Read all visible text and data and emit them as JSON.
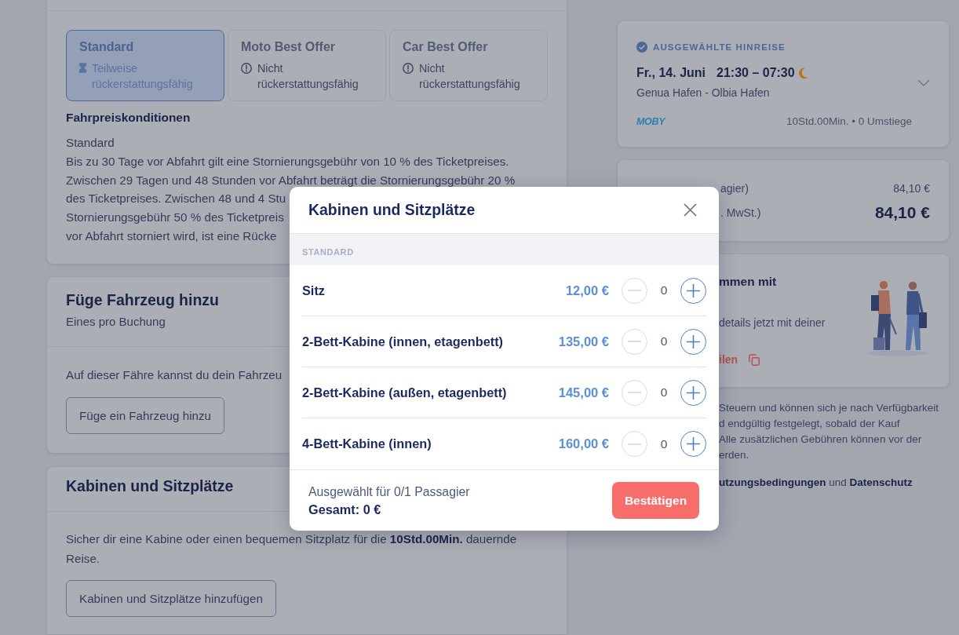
{
  "fare_section": {
    "options": [
      {
        "title": "Standard",
        "refund": "Teilweise rückerstattungsfähig",
        "kind": "partial",
        "selected": true
      },
      {
        "title": "Moto Best Offer",
        "refund": "Nicht rückerstattungsfähig",
        "kind": "nonrefundable",
        "selected": false
      },
      {
        "title": "Car Best Offer",
        "refund": "Nicht rückerstattungsfähig",
        "kind": "nonrefundable",
        "selected": false
      }
    ],
    "conditions_title": "Fahrpreiskonditionen",
    "conditions_lines": [
      "Standard",
      "Bis zu 30 Tage vor Abfahrt gilt eine Stornierungsgebühr von 10 % des Ticketpreises.",
      "Zwischen 29 Tagen und 48 Stunden vor Abfahrt beträgt die Stornierungsgebühr 20 %",
      "des Ticketpreises. Zwischen 48 und 4 Stu",
      "Stornierungsgebühr 50 % des Ticketpreis",
      "vor Abfahrt storniert wird, ist eine Rücke"
    ]
  },
  "vehicle_section": {
    "title": "Füge Fahrzeug hinzu",
    "subtitle": "Eines pro Buchung",
    "text": "Auf dieser Fähre kannst du dein Fahrzeu",
    "button": "Füge ein Fahrzeug hinzu"
  },
  "cabin_section": {
    "title": "Kabinen und Sitzplätze",
    "text": "Sicher dir eine Kabine oder einen bequemen Sitzplatz für die **10Std.00Min.** dauernde Reise.",
    "button": "Kabinen und Sitzplätze hinzufügen"
  },
  "trip_card": {
    "label": "AUSGEWÄHLTE HINREISE",
    "date": "Fr., 14. Juni",
    "times": "21:30 – 07:30",
    "night": true,
    "route": "Genua Hafen - Olbia Hafen",
    "operator": "MOBY",
    "duration": "10Std.00Min. • 0 Umstiege"
  },
  "price_card": {
    "rows": [
      {
        "label": "agier)",
        "amount": "84,10 €",
        "kind": "item"
      },
      {
        "label": ". MwSt.)",
        "amount": "84,10 €",
        "kind": "total"
      }
    ]
  },
  "share_card": {
    "title": "mmen mit",
    "text": "details jetzt mit deiner",
    "link": "ilen"
  },
  "price_note_lines": [
    "Steuern und können sich je nach Verfügbarkeit",
    "d endgültig festgelegt, sobald der Kauf",
    "Alle zusätzlichen Gebühren können vor der",
    "erden."
  ],
  "legal_line": [
    {
      "text": "utzungsbedingungen",
      "kind": "link"
    },
    {
      "text": "und",
      "kind": "plain"
    },
    {
      "text": "Datenschutz",
      "kind": "link"
    }
  ],
  "modal": {
    "title": "Kabinen und Sitzplätze",
    "section": "STANDARD",
    "rows": [
      {
        "name": "Sitz",
        "price": "12,00 €",
        "count": "0",
        "decrease_disabled": true
      },
      {
        "name": "2-Bett-Kabine (innen, etagenbett)",
        "price": "135,00 €",
        "count": "0",
        "decrease_disabled": true
      },
      {
        "name": "2-Bett-Kabine (außen, etagenbett)",
        "price": "145,00 €",
        "count": "0",
        "decrease_disabled": true
      },
      {
        "name": "4-Bett-Kabine (innen)",
        "price": "160,00 €",
        "count": "0",
        "decrease_disabled": true
      }
    ],
    "selected_info": "Ausgewählt für 0/1 Passagier",
    "total": "Gesamt: 0 €",
    "confirm": "Bestätigen"
  }
}
